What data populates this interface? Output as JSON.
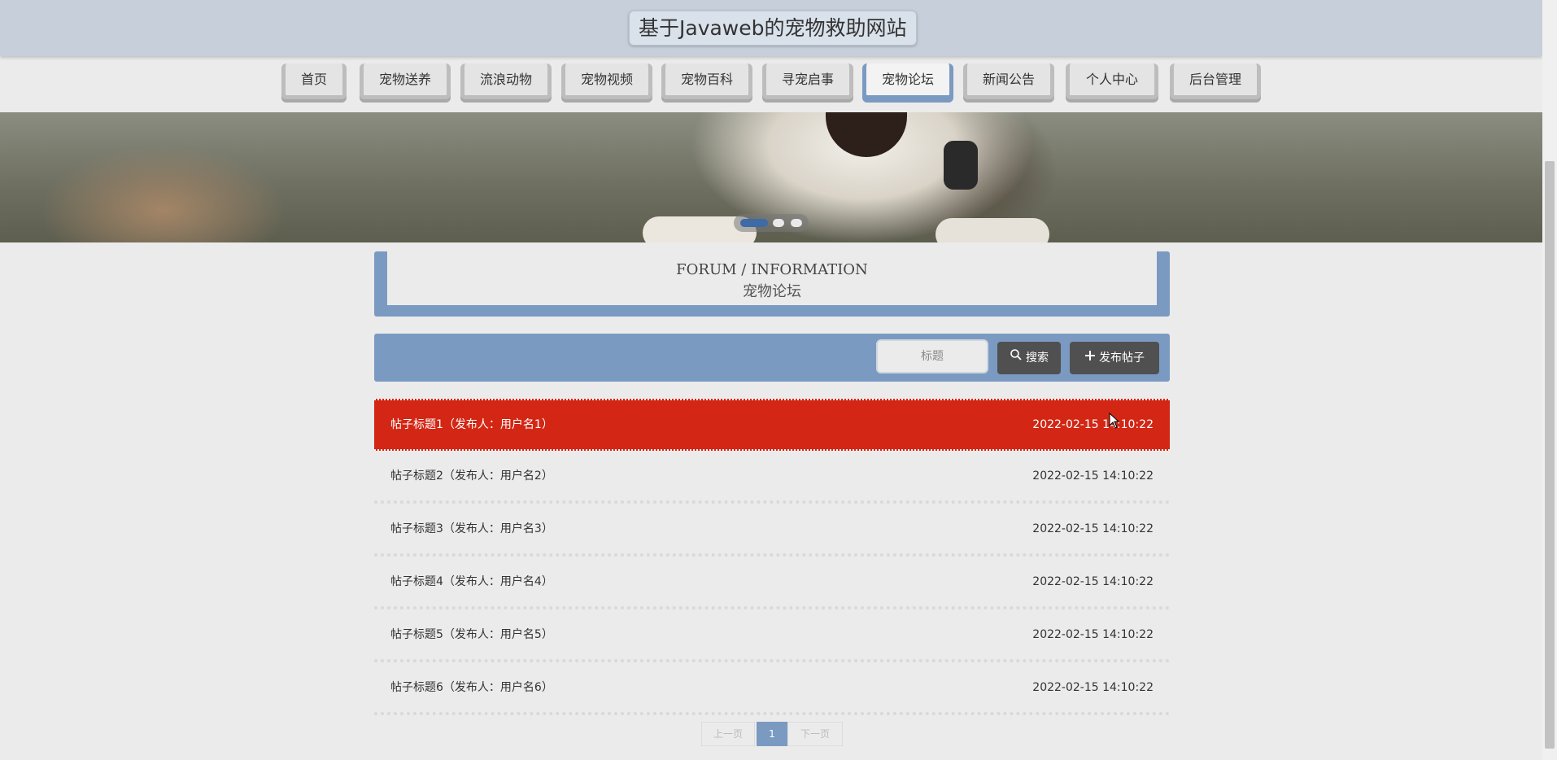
{
  "site": {
    "title": "基于Javaweb的宠物救助网站"
  },
  "nav": {
    "items": [
      {
        "label": "首页"
      },
      {
        "label": "宠物送养"
      },
      {
        "label": "流浪动物"
      },
      {
        "label": "宠物视频"
      },
      {
        "label": "宠物百科"
      },
      {
        "label": "寻宠启事"
      },
      {
        "label": "宠物论坛",
        "active": true
      },
      {
        "label": "新闻公告"
      },
      {
        "label": "个人中心"
      },
      {
        "label": "后台管理"
      }
    ]
  },
  "banner": {
    "slides": 3,
    "active_slide": 1
  },
  "heading": {
    "en": "FORUM / INFORMATION",
    "cn": "宠物论坛"
  },
  "toolbar": {
    "search_placeholder": "标题",
    "search_label": "搜索",
    "post_label": "发布帖子"
  },
  "posts": [
    {
      "title": "帖子标题1（发布人：用户名1）",
      "date": "2022-02-15 14:10:22",
      "active": true
    },
    {
      "title": "帖子标题2（发布人：用户名2）",
      "date": "2022-02-15 14:10:22"
    },
    {
      "title": "帖子标题3（发布人：用户名3）",
      "date": "2022-02-15 14:10:22"
    },
    {
      "title": "帖子标题4（发布人：用户名4）",
      "date": "2022-02-15 14:10:22"
    },
    {
      "title": "帖子标题5（发布人：用户名5）",
      "date": "2022-02-15 14:10:22"
    },
    {
      "title": "帖子标题6（发布人：用户名6）",
      "date": "2022-02-15 14:10:22"
    }
  ],
  "pager": {
    "prev": "上一页",
    "current": "1",
    "next": "下一页"
  },
  "colors": {
    "accent": "#7b9ac2",
    "highlight": "#d32614",
    "header": "#c6cfda",
    "button": "#505050"
  }
}
